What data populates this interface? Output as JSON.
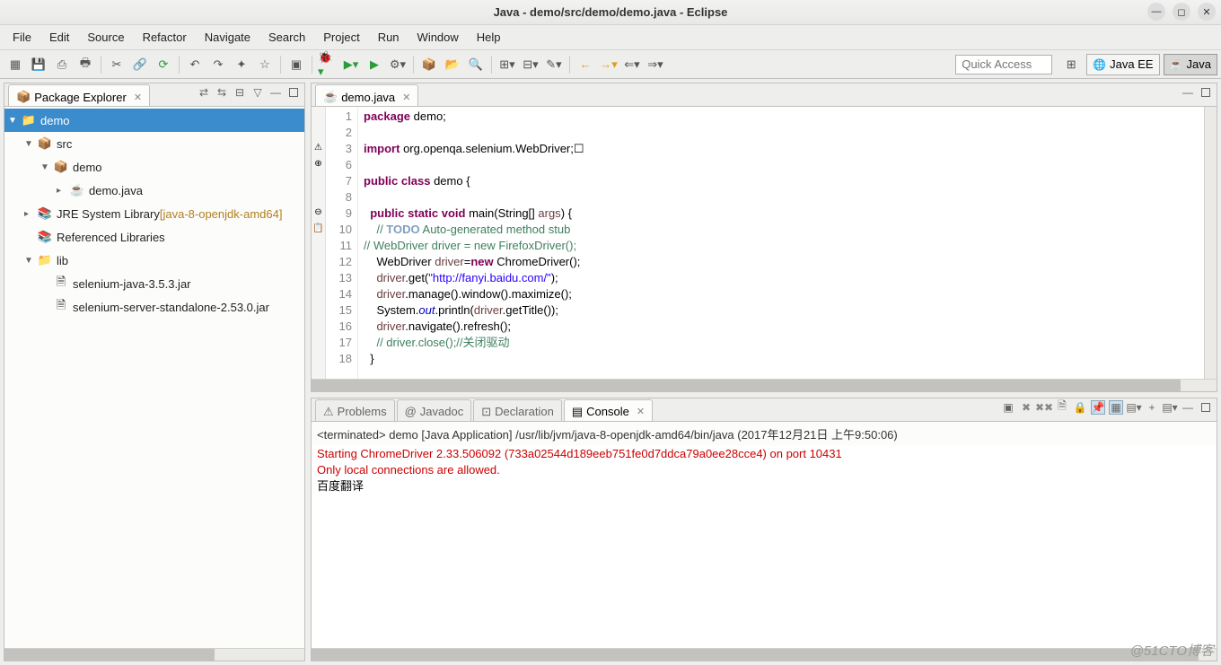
{
  "window": {
    "title": "Java - demo/src/demo/demo.java - Eclipse"
  },
  "menus": [
    "File",
    "Edit",
    "Source",
    "Refactor",
    "Navigate",
    "Search",
    "Project",
    "Run",
    "Window",
    "Help"
  ],
  "quick_access_placeholder": "Quick Access",
  "perspectives": [
    {
      "label": "Java EE",
      "active": false
    },
    {
      "label": "Java",
      "active": true
    }
  ],
  "packageExplorer": {
    "title": "Package Explorer",
    "tree": [
      {
        "indent": 0,
        "arrow": "▼",
        "icon": "📁",
        "label": "demo",
        "selected": true
      },
      {
        "indent": 1,
        "arrow": "▼",
        "icon": "📦",
        "label": "src"
      },
      {
        "indent": 2,
        "arrow": "▼",
        "icon": "📦",
        "label": "demo"
      },
      {
        "indent": 3,
        "arrow": "▸",
        "icon": "☕",
        "label": "demo.java"
      },
      {
        "indent": 1,
        "arrow": "▸",
        "icon": "📚",
        "label": "JRE System Library",
        "decoration": "[java-8-openjdk-amd64]"
      },
      {
        "indent": 1,
        "arrow": "",
        "icon": "📚",
        "label": "Referenced Libraries"
      },
      {
        "indent": 1,
        "arrow": "▼",
        "icon": "📁",
        "label": "lib"
      },
      {
        "indent": 2,
        "arrow": "",
        "icon": "🗎",
        "label": "selenium-java-3.5.3.jar"
      },
      {
        "indent": 2,
        "arrow": "",
        "icon": "🗎",
        "label": "selenium-server-standalone-2.53.0.jar"
      }
    ]
  },
  "editor": {
    "tab": "demo.java",
    "lines": [
      1,
      2,
      3,
      6,
      7,
      8,
      9,
      10,
      11,
      12,
      13,
      14,
      15,
      16,
      17,
      18
    ],
    "code_html": "<span class='kw'>package</span> demo;\n\n<span class='kw'>import</span> org.openqa.selenium.WebDriver;☐\n\n<span class='kw'>public</span> <span class='kw'>class</span> demo {\n\n  <span class='kw'>public</span> <span class='kw'>static</span> <span class='kw'>void</span> main(String[] <span class='arg'>args</span>) {\n    <span class='cmt'>// <span class='tag'>TODO</span> Auto-generated method stub</span>\n<span class='cmt'>// WebDriver driver = new FirefoxDriver();</span>\n    WebDriver <span class='arg'>driver</span>=<span class='kw'>new</span> ChromeDriver();\n    <span class='arg'>driver</span>.get(<span class='str'>\"http://fanyi.baidu.com/\"</span>);\n    <span class='arg'>driver</span>.manage().window().maximize();\n    System.<span class='field'>out</span>.println(<span class='arg'>driver</span>.getTitle());\n    <span class='arg'>driver</span>.navigate().refresh();\n    <span class='cmt'>// driver.close();//关闭驱动</span>\n  }"
  },
  "bottomTabs": [
    "Problems",
    "Javadoc",
    "Declaration",
    "Console"
  ],
  "bottomActiveTab": 3,
  "console": {
    "status": "<terminated> demo [Java Application] /usr/lib/jvm/java-8-openjdk-amd64/bin/java (2017年12月21日 上午9:50:06)",
    "lines": [
      {
        "cls": "err",
        "text": "Starting ChromeDriver 2.33.506092 (733a02544d189eeb751fe0d7ddca79a0ee28cce4) on port 10431"
      },
      {
        "cls": "err",
        "text": "Only local connections are allowed."
      },
      {
        "cls": "",
        "text": "百度翻译"
      }
    ]
  },
  "watermark": "@51CTO博客"
}
